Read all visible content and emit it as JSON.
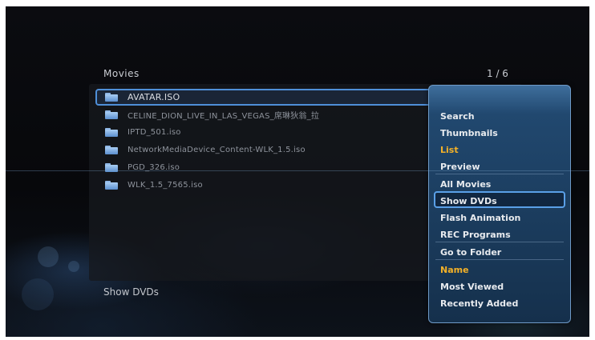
{
  "browser": {
    "title": "Movies",
    "page_counter": "1 / 6",
    "status": "Show DVDs",
    "files": [
      {
        "name": "AVATAR.ISO",
        "selected": true
      },
      {
        "name": "CELINE_DION_LIVE_IN_LAS_VEGAS_席琳狄翁_拉",
        "selected": false
      },
      {
        "name": "IPTD_501.iso",
        "selected": false
      },
      {
        "name": "NetworkMediaDevice_Content-WLK_1.5.iso",
        "selected": false
      },
      {
        "name": "PGD_326.iso",
        "selected": false
      },
      {
        "name": "WLK_1.5_7565.iso",
        "selected": false
      }
    ],
    "file_icon": "folder-icon"
  },
  "menu": {
    "groups": [
      [
        {
          "label": "Search"
        },
        {
          "label": "Thumbnails"
        },
        {
          "label": "List",
          "active": true
        },
        {
          "label": "Preview"
        }
      ],
      [
        {
          "label": "All Movies"
        },
        {
          "label": "Show DVDs",
          "focused": true
        },
        {
          "label": "Flash Animation"
        },
        {
          "label": "REC Programs"
        }
      ],
      [
        {
          "label": "Go to Folder"
        }
      ],
      [
        {
          "label": "Name",
          "active": true
        },
        {
          "label": "Most Viewed"
        },
        {
          "label": "Recently Added"
        }
      ]
    ]
  },
  "colors": {
    "accent": "#4f8fd8",
    "active_text": "#f3b128",
    "menu_bg": "#1f4467"
  }
}
